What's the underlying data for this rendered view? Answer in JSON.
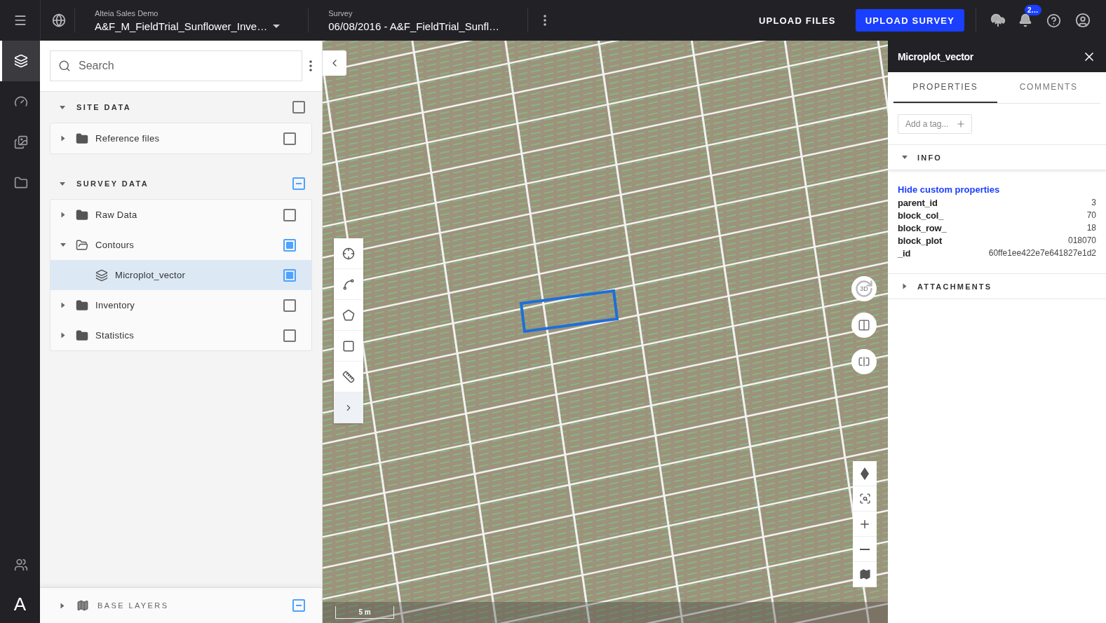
{
  "top_bar": {
    "project_label": "Alteia Sales Demo",
    "project_name": "A&F_M_FieldTrial_Sunflower_Inve…",
    "survey_label": "Survey",
    "survey_name": "06/08/2016 - A&F_FieldTrial_Sunfl…",
    "upload_files": "UPLOAD FILES",
    "upload_survey": "UPLOAD SURVEY",
    "notification_count": "2…"
  },
  "nav_rail": {
    "items": [
      {
        "kind": "layers",
        "selected": true
      },
      {
        "kind": "dashboard",
        "selected": false
      },
      {
        "kind": "gallery",
        "selected": false
      },
      {
        "kind": "folder",
        "selected": false
      }
    ],
    "bottom_items": [
      {
        "kind": "users",
        "selected": false
      }
    ],
    "logo": "A"
  },
  "layers_panel": {
    "search_placeholder": "Search",
    "sections": [
      {
        "title": "SITE DATA",
        "expanded": true,
        "checked": false,
        "items": [
          {
            "label": "Reference files",
            "kind": "folder",
            "expanded": false,
            "checked": false,
            "selected": false
          }
        ]
      },
      {
        "title": "SURVEY DATA",
        "expanded": true,
        "checked": true,
        "partial": true,
        "items": [
          {
            "label": "Raw Data",
            "kind": "folder",
            "expanded": false,
            "checked": false,
            "selected": false
          },
          {
            "label": "Contours",
            "kind": "folder",
            "expanded": true,
            "checked": true,
            "partial": false,
            "selected": false,
            "children": [
              {
                "label": "Microplot_vector",
                "kind": "layer",
                "checked": true,
                "partial": false,
                "selected": true
              }
            ]
          },
          {
            "label": "Inventory",
            "kind": "folder",
            "expanded": false,
            "checked": false,
            "selected": false
          },
          {
            "label": "Statistics",
            "kind": "folder",
            "expanded": false,
            "checked": false,
            "selected": false
          }
        ]
      }
    ],
    "base_layers": {
      "title": "BASE LAYERS",
      "expanded": false,
      "checked": true,
      "partial": true
    }
  },
  "map": {
    "tools": [
      {
        "kind": "point"
      },
      {
        "kind": "line"
      },
      {
        "kind": "polygon"
      },
      {
        "kind": "rectangle"
      },
      {
        "kind": "measure"
      },
      {
        "kind": "expand"
      }
    ],
    "view_label": "3D",
    "scale": "5 m"
  },
  "details_panel": {
    "title": "Microplot_vector",
    "tabs": [
      {
        "label": "PROPERTIES",
        "selected": true
      },
      {
        "label": "COMMENTS",
        "selected": false
      }
    ],
    "tag_placeholder": "Add a tag...",
    "info": {
      "title": "INFO",
      "expanded": true,
      "link": "Hide custom properties",
      "properties": [
        {
          "name": "parent_id",
          "value": "3"
        },
        {
          "name": "block_col_",
          "value": "70"
        },
        {
          "name": "block_row_",
          "value": "18"
        },
        {
          "name": "block_plot",
          "value": "018070"
        },
        {
          "name": "_id",
          "value": "60ffe1ee422e7e641827e1d2"
        }
      ]
    },
    "attachments": {
      "title": "ATTACHMENTS",
      "expanded": false
    }
  }
}
